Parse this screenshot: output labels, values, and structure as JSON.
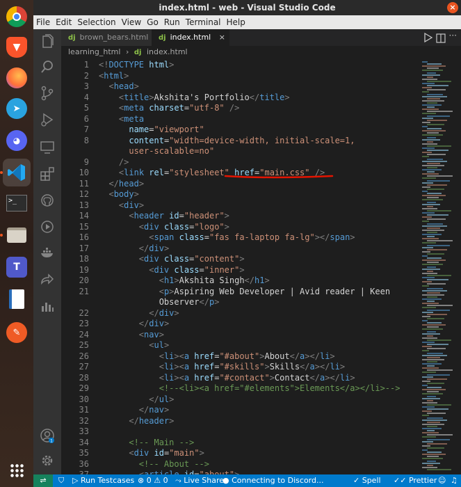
{
  "window": {
    "title": "index.html - web - Visual Studio Code",
    "close": "×"
  },
  "menu": [
    "File",
    "Edit",
    "Selection",
    "View",
    "Go",
    "Run",
    "Terminal",
    "Help"
  ],
  "tabs": [
    {
      "label": "brown_bears.html",
      "icon": "dj",
      "active": false
    },
    {
      "label": "index.html",
      "icon": "dj",
      "active": true,
      "close": "×"
    }
  ],
  "breadcrumb": {
    "folder": "learning_html",
    "sep": "›",
    "file_icon": "dj",
    "file": "index.html"
  },
  "code_lines": [
    {
      "n": "1",
      "code": [
        [
          "t-punct",
          "<!"
        ],
        [
          "t-tag",
          "DOCTYPE"
        ],
        [
          "t-attr",
          " html"
        ],
        [
          "t-punct",
          ">"
        ]
      ]
    },
    {
      "n": "2",
      "code": [
        [
          "t-punct",
          "<"
        ],
        [
          "t-tag",
          "html"
        ],
        [
          "t-punct",
          ">"
        ]
      ]
    },
    {
      "n": "3",
      "code": [
        [
          "t-text",
          "  "
        ],
        [
          "t-punct",
          "<"
        ],
        [
          "t-tag",
          "head"
        ],
        [
          "t-punct",
          ">"
        ]
      ]
    },
    {
      "n": "4",
      "code": [
        [
          "t-text",
          "    "
        ],
        [
          "t-punct",
          "<"
        ],
        [
          "t-tag",
          "title"
        ],
        [
          "t-punct",
          ">"
        ],
        [
          "t-text",
          "Akshita's Portfolio"
        ],
        [
          "t-punct",
          "</"
        ],
        [
          "t-tag",
          "title"
        ],
        [
          "t-punct",
          ">"
        ]
      ]
    },
    {
      "n": "5",
      "code": [
        [
          "t-text",
          "    "
        ],
        [
          "t-punct",
          "<"
        ],
        [
          "t-tag",
          "meta"
        ],
        [
          "t-attr",
          " charset"
        ],
        [
          "t-text",
          "="
        ],
        [
          "t-str",
          "\"utf-8\""
        ],
        [
          "t-punct",
          " />"
        ]
      ]
    },
    {
      "n": "6",
      "code": [
        [
          "t-text",
          "    "
        ],
        [
          "t-punct",
          "<"
        ],
        [
          "t-tag",
          "meta"
        ]
      ]
    },
    {
      "n": "7",
      "code": [
        [
          "t-text",
          "      "
        ],
        [
          "t-attr",
          "name"
        ],
        [
          "t-text",
          "="
        ],
        [
          "t-str",
          "\"viewport\""
        ]
      ]
    },
    {
      "n": "8",
      "code": [
        [
          "t-text",
          "      "
        ],
        [
          "t-attr",
          "content"
        ],
        [
          "t-text",
          "="
        ],
        [
          "t-str",
          "\"width=device-width, initial-scale=1,"
        ]
      ]
    },
    {
      "n": "",
      "code": [
        [
          "t-str",
          "      user-scalable=no\""
        ]
      ]
    },
    {
      "n": "9",
      "code": [
        [
          "t-text",
          "    "
        ],
        [
          "t-punct",
          "/>"
        ]
      ]
    },
    {
      "n": "10",
      "code": [
        [
          "t-text",
          "    "
        ],
        [
          "t-punct",
          "<"
        ],
        [
          "t-tag",
          "link"
        ],
        [
          "t-attr",
          " rel"
        ],
        [
          "t-text",
          "="
        ],
        [
          "t-str",
          "\"stylesheet\""
        ],
        [
          "t-attr",
          " href"
        ],
        [
          "t-text",
          "="
        ],
        [
          "t-str",
          "\"main.css\""
        ],
        [
          "t-punct",
          " />"
        ]
      ]
    },
    {
      "n": "11",
      "code": [
        [
          "t-text",
          "  "
        ],
        [
          "t-punct",
          "</"
        ],
        [
          "t-tag",
          "head"
        ],
        [
          "t-punct",
          ">"
        ]
      ]
    },
    {
      "n": "12",
      "code": [
        [
          "t-text",
          "  "
        ],
        [
          "t-punct",
          "<"
        ],
        [
          "t-tag",
          "body"
        ],
        [
          "t-punct",
          ">"
        ]
      ]
    },
    {
      "n": "13",
      "code": [
        [
          "t-text",
          "    "
        ],
        [
          "t-punct",
          "<"
        ],
        [
          "t-tag",
          "div"
        ],
        [
          "t-punct",
          ">"
        ]
      ]
    },
    {
      "n": "14",
      "code": [
        [
          "t-text",
          "      "
        ],
        [
          "t-punct",
          "<"
        ],
        [
          "t-tag",
          "header"
        ],
        [
          "t-attr",
          " id"
        ],
        [
          "t-text",
          "="
        ],
        [
          "t-str",
          "\"header\""
        ],
        [
          "t-punct",
          ">"
        ]
      ]
    },
    {
      "n": "15",
      "code": [
        [
          "t-text",
          "        "
        ],
        [
          "t-punct",
          "<"
        ],
        [
          "t-tag",
          "div"
        ],
        [
          "t-attr",
          " class"
        ],
        [
          "t-text",
          "="
        ],
        [
          "t-str",
          "\"logo\""
        ],
        [
          "t-punct",
          ">"
        ]
      ]
    },
    {
      "n": "16",
      "code": [
        [
          "t-text",
          "          "
        ],
        [
          "t-punct",
          "<"
        ],
        [
          "t-tag",
          "span"
        ],
        [
          "t-attr",
          " class"
        ],
        [
          "t-text",
          "="
        ],
        [
          "t-str",
          "\"fas fa-laptop fa-lg\""
        ],
        [
          "t-punct",
          "></"
        ],
        [
          "t-tag",
          "span"
        ],
        [
          "t-punct",
          ">"
        ]
      ]
    },
    {
      "n": "17",
      "code": [
        [
          "t-text",
          "        "
        ],
        [
          "t-punct",
          "</"
        ],
        [
          "t-tag",
          "div"
        ],
        [
          "t-punct",
          ">"
        ]
      ]
    },
    {
      "n": "18",
      "code": [
        [
          "t-text",
          "        "
        ],
        [
          "t-punct",
          "<"
        ],
        [
          "t-tag",
          "div"
        ],
        [
          "t-attr",
          " class"
        ],
        [
          "t-text",
          "="
        ],
        [
          "t-str",
          "\"content\""
        ],
        [
          "t-punct",
          ">"
        ]
      ]
    },
    {
      "n": "19",
      "code": [
        [
          "t-text",
          "          "
        ],
        [
          "t-punct",
          "<"
        ],
        [
          "t-tag",
          "div"
        ],
        [
          "t-attr",
          " class"
        ],
        [
          "t-text",
          "="
        ],
        [
          "t-str",
          "\"inner\""
        ],
        [
          "t-punct",
          ">"
        ]
      ]
    },
    {
      "n": "20",
      "code": [
        [
          "t-text",
          "            "
        ],
        [
          "t-punct",
          "<"
        ],
        [
          "t-tag",
          "h1"
        ],
        [
          "t-punct",
          ">"
        ],
        [
          "t-text",
          "Akshita Singh"
        ],
        [
          "t-punct",
          "</"
        ],
        [
          "t-tag",
          "h1"
        ],
        [
          "t-punct",
          ">"
        ]
      ]
    },
    {
      "n": "21",
      "code": [
        [
          "t-text",
          "            "
        ],
        [
          "t-punct",
          "<"
        ],
        [
          "t-tag",
          "p"
        ],
        [
          "t-punct",
          ">"
        ],
        [
          "t-text",
          "Aspiring Web Developer | Avid reader | Keen"
        ]
      ]
    },
    {
      "n": "",
      "code": [
        [
          "t-text",
          "            Observer"
        ],
        [
          "t-punct",
          "</"
        ],
        [
          "t-tag",
          "p"
        ],
        [
          "t-punct",
          ">"
        ]
      ]
    },
    {
      "n": "22",
      "code": [
        [
          "t-text",
          "          "
        ],
        [
          "t-punct",
          "</"
        ],
        [
          "t-tag",
          "div"
        ],
        [
          "t-punct",
          ">"
        ]
      ]
    },
    {
      "n": "23",
      "code": [
        [
          "t-text",
          "        "
        ],
        [
          "t-punct",
          "</"
        ],
        [
          "t-tag",
          "div"
        ],
        [
          "t-punct",
          ">"
        ]
      ]
    },
    {
      "n": "24",
      "code": [
        [
          "t-text",
          "        "
        ],
        [
          "t-punct",
          "<"
        ],
        [
          "t-tag",
          "nav"
        ],
        [
          "t-punct",
          ">"
        ]
      ]
    },
    {
      "n": "25",
      "code": [
        [
          "t-text",
          "          "
        ],
        [
          "t-punct",
          "<"
        ],
        [
          "t-tag",
          "ul"
        ],
        [
          "t-punct",
          ">"
        ]
      ]
    },
    {
      "n": "26",
      "code": [
        [
          "t-text",
          "            "
        ],
        [
          "t-punct",
          "<"
        ],
        [
          "t-tag",
          "li"
        ],
        [
          "t-punct",
          "><"
        ],
        [
          "t-tag",
          "a"
        ],
        [
          "t-attr",
          " href"
        ],
        [
          "t-text",
          "="
        ],
        [
          "t-str",
          "\"#about\""
        ],
        [
          "t-punct",
          ">"
        ],
        [
          "t-text",
          "About"
        ],
        [
          "t-punct",
          "</"
        ],
        [
          "t-tag",
          "a"
        ],
        [
          "t-punct",
          "></"
        ],
        [
          "t-tag",
          "li"
        ],
        [
          "t-punct",
          ">"
        ]
      ]
    },
    {
      "n": "27",
      "code": [
        [
          "t-text",
          "            "
        ],
        [
          "t-punct",
          "<"
        ],
        [
          "t-tag",
          "li"
        ],
        [
          "t-punct",
          "><"
        ],
        [
          "t-tag",
          "a"
        ],
        [
          "t-attr",
          " href"
        ],
        [
          "t-text",
          "="
        ],
        [
          "t-str",
          "\"#skills\""
        ],
        [
          "t-punct",
          ">"
        ],
        [
          "t-text",
          "Skills"
        ],
        [
          "t-punct",
          "</"
        ],
        [
          "t-tag",
          "a"
        ],
        [
          "t-punct",
          "></"
        ],
        [
          "t-tag",
          "li"
        ],
        [
          "t-punct",
          ">"
        ]
      ]
    },
    {
      "n": "28",
      "code": [
        [
          "t-text",
          "            "
        ],
        [
          "t-punct",
          "<"
        ],
        [
          "t-tag",
          "li"
        ],
        [
          "t-punct",
          "><"
        ],
        [
          "t-tag",
          "a"
        ],
        [
          "t-attr",
          " href"
        ],
        [
          "t-text",
          "="
        ],
        [
          "t-str",
          "\"#contact\""
        ],
        [
          "t-punct",
          ">"
        ],
        [
          "t-text",
          "Contact"
        ],
        [
          "t-punct",
          "</"
        ],
        [
          "t-tag",
          "a"
        ],
        [
          "t-punct",
          "></"
        ],
        [
          "t-tag",
          "li"
        ],
        [
          "t-punct",
          ">"
        ]
      ]
    },
    {
      "n": "29",
      "code": [
        [
          "t-text",
          "            "
        ],
        [
          "t-comment",
          "<!--<li><a href=\"#elements\">Elements</a></li>-->"
        ]
      ]
    },
    {
      "n": "30",
      "code": [
        [
          "t-text",
          "          "
        ],
        [
          "t-punct",
          "</"
        ],
        [
          "t-tag",
          "ul"
        ],
        [
          "t-punct",
          ">"
        ]
      ]
    },
    {
      "n": "31",
      "code": [
        [
          "t-text",
          "        "
        ],
        [
          "t-punct",
          "</"
        ],
        [
          "t-tag",
          "nav"
        ],
        [
          "t-punct",
          ">"
        ]
      ]
    },
    {
      "n": "32",
      "code": [
        [
          "t-text",
          "      "
        ],
        [
          "t-punct",
          "</"
        ],
        [
          "t-tag",
          "header"
        ],
        [
          "t-punct",
          ">"
        ]
      ]
    },
    {
      "n": "33",
      "code": []
    },
    {
      "n": "34",
      "code": [
        [
          "t-text",
          "      "
        ],
        [
          "t-comment",
          "<!-- Main -->"
        ]
      ]
    },
    {
      "n": "35",
      "code": [
        [
          "t-text",
          "      "
        ],
        [
          "t-punct",
          "<"
        ],
        [
          "t-tag",
          "div"
        ],
        [
          "t-attr",
          " id"
        ],
        [
          "t-text",
          "="
        ],
        [
          "t-str",
          "\"main\""
        ],
        [
          "t-punct",
          ">"
        ]
      ]
    },
    {
      "n": "36",
      "code": [
        [
          "t-text",
          "        "
        ],
        [
          "t-comment",
          "<!-- About -->"
        ]
      ]
    },
    {
      "n": "37",
      "code": [
        [
          "t-text",
          "        "
        ],
        [
          "t-punct",
          "<"
        ],
        [
          "t-tag",
          "article"
        ],
        [
          "t-attr",
          " id"
        ],
        [
          "t-text",
          "="
        ],
        [
          "t-str",
          "\"about\""
        ],
        [
          "t-punct",
          ">"
        ]
      ]
    }
  ],
  "status": {
    "test": "Run Testcases",
    "problems_icon": "⊗",
    "errors": "0",
    "warnings_icon": "⚠",
    "warnings": "0",
    "liveshare": "Live Share",
    "discord": "Connecting to Discord...",
    "spell": "Spell",
    "prettier": "Prettier"
  },
  "colors": {
    "accent": "#007acc",
    "annotation": "#e51400",
    "tab_icon": "#8dc149"
  }
}
